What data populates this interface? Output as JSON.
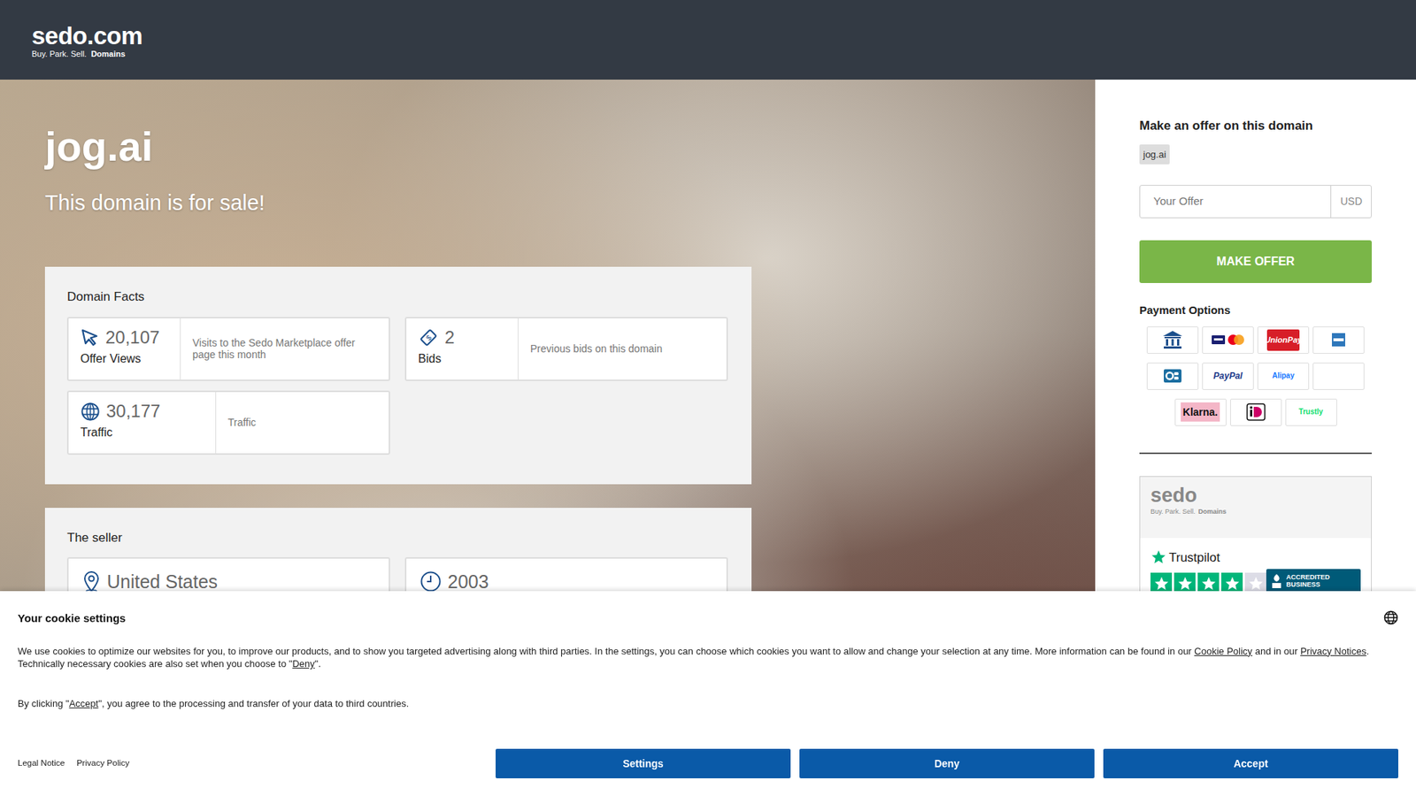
{
  "header": {
    "logo": "sedo.com",
    "tagline": "Buy. Park. Sell.",
    "tagline_bold": "Domains"
  },
  "hero": {
    "title": "jog.ai",
    "subtitle": "This domain is for sale!"
  },
  "facts": {
    "title": "Domain Facts",
    "items": [
      {
        "kind": "views",
        "value": "20,107",
        "label": "Offer Views",
        "description": "Visits to the Sedo Marketplace offer page this month"
      },
      {
        "kind": "bids",
        "value": "2",
        "label": "Bids",
        "description": "Previous bids on this domain"
      },
      {
        "kind": "traffic",
        "value": "30,177",
        "label": "Traffic",
        "description": "Traffic"
      }
    ]
  },
  "seller": {
    "title": "The seller",
    "items": [
      {
        "kind": "location",
        "value": "United States"
      },
      {
        "kind": "since",
        "value": "2003"
      }
    ]
  },
  "offer": {
    "title": "Make an offer on this domain",
    "domain": "jog.ai",
    "placeholder": "Your Offer",
    "currency": "USD",
    "button": "MAKE OFFER"
  },
  "payment": {
    "title": "Payment Options",
    "methods": [
      {
        "kind": "bank"
      },
      {
        "kind": "cards"
      },
      {
        "kind": "unionpay",
        "label": "UnionPay"
      },
      {
        "kind": "amex"
      },
      {
        "kind": "cb"
      },
      {
        "kind": "paypal",
        "label": "PayPal"
      },
      {
        "kind": "alipay",
        "label": "Alipay"
      },
      {
        "kind": "blank"
      },
      {
        "kind": "klarna",
        "label": "Klarna."
      },
      {
        "kind": "ideal"
      },
      {
        "kind": "trustly",
        "label": "Trustly"
      }
    ]
  },
  "trust": {
    "logo": "sedo",
    "tagline": "Buy. Park. Sell.",
    "tagline_bold": "Domains",
    "trustpilot": "Trustpilot",
    "stars": 4,
    "bbb": "ACCREDITED BUSINESS"
  },
  "cookies": {
    "title": "Your cookie settings",
    "paragraphs": [
      {
        "segments": [
          {
            "text": "We use cookies to optimize our websites for you, to improve our products, and to show you targeted advertising along with third parties. In the settings, you can choose which cookies you want to allow and change your selection at any time. More information can be found in our ",
            "link": false
          },
          {
            "text": "Cookie Policy",
            "link": true
          },
          {
            "text": " and in our ",
            "link": false
          },
          {
            "text": "Privacy Notices",
            "link": true
          },
          {
            "text": ". Technically necessary cookies are also set when you choose to \"",
            "link": false
          },
          {
            "text": "Deny",
            "link": true
          },
          {
            "text": "\".",
            "link": false
          }
        ]
      },
      {
        "segments": [
          {
            "text": "By clicking \"",
            "link": false
          },
          {
            "text": "Accept",
            "link": true
          },
          {
            "text": "\", you agree to the processing and transfer of your data to third countries.",
            "link": false
          }
        ]
      }
    ],
    "links": [
      "Legal Notice",
      "Privacy Policy"
    ],
    "buttons": [
      "Settings",
      "Deny",
      "Accept"
    ]
  }
}
